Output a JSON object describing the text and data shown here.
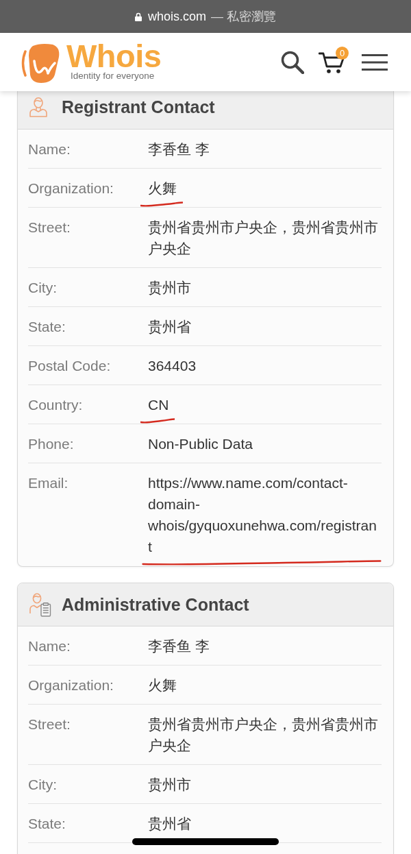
{
  "browser_bar": {
    "url": "whois.com",
    "mode": "— 私密瀏覽"
  },
  "header": {
    "wordmark": "Whois",
    "tagline": "Identity for everyone",
    "cart_count": "0"
  },
  "sections": [
    {
      "kind": "registrant",
      "title": "Registrant Contact",
      "cut_off": false,
      "rows": [
        {
          "label": "Name:",
          "lines": [
            "李香鱼 李"
          ],
          "marked": false
        },
        {
          "label": "Organization:",
          "lines": [
            "火舞"
          ],
          "marked": true
        },
        {
          "label": "Street:",
          "lines": [
            "贵州省贵州市户央企，贵州省贵州市",
            "户央企"
          ],
          "marked": false
        },
        {
          "label": "City:",
          "lines": [
            "贵州市"
          ],
          "marked": false
        },
        {
          "label": "State:",
          "lines": [
            "贵州省"
          ],
          "marked": false
        },
        {
          "label": "Postal Code:",
          "lines": [
            "364403"
          ],
          "marked": false
        },
        {
          "label": "Country:",
          "lines": [
            "CN"
          ],
          "marked": true
        },
        {
          "label": "Phone:",
          "lines": [
            "Non-Public Data"
          ],
          "marked": false
        },
        {
          "label": "Email:",
          "lines": [
            "https://www.name.com/contact-",
            "domain-",
            "whois/gyquoxunehwa.com/registran",
            "t"
          ],
          "marked": true
        }
      ]
    },
    {
      "kind": "administrative",
      "title": "Administrative Contact",
      "cut_off": true,
      "rows": [
        {
          "label": "Name:",
          "lines": [
            "李香鱼 李"
          ],
          "marked": false
        },
        {
          "label": "Organization:",
          "lines": [
            "火舞"
          ],
          "marked": false
        },
        {
          "label": "Street:",
          "lines": [
            "贵州省贵州市户央企，贵州省贵州市",
            "户央企"
          ],
          "marked": false
        },
        {
          "label": "City:",
          "lines": [
            "贵州市"
          ],
          "marked": false
        },
        {
          "label": "State:",
          "lines": [
            "贵州省"
          ],
          "marked": false
        }
      ]
    }
  ]
}
